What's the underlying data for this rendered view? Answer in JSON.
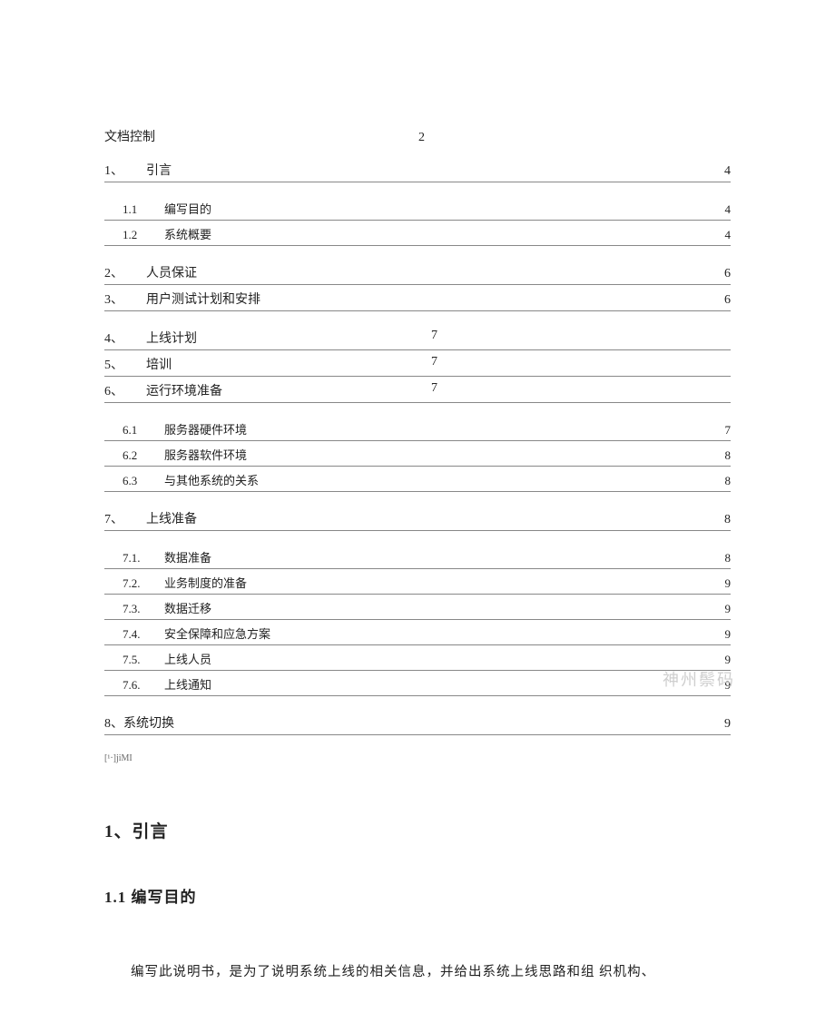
{
  "toc_header": {
    "label": "文档控制",
    "page": "2"
  },
  "toc": [
    {
      "lvl": 1,
      "num": "1、",
      "title": "引言",
      "page": "4",
      "align": "right",
      "gap": true
    },
    {
      "lvl": 2,
      "num": "1.1",
      "title": "编写目的",
      "page": "4",
      "align": "right"
    },
    {
      "lvl": 2,
      "num": "1.2",
      "title": "系统概要",
      "page": "4",
      "align": "right",
      "gap": true
    },
    {
      "lvl": 1,
      "num": "2、",
      "title": "人员保证",
      "page": "6",
      "align": "right"
    },
    {
      "lvl": 1,
      "num": "3、",
      "title": "用户测试计划和安排",
      "page": "6",
      "align": "right",
      "gap": true
    },
    {
      "lvl": 1,
      "num": "4、",
      "title": "上线计划",
      "page": "7",
      "align": "mid"
    },
    {
      "lvl": 1,
      "num": "5、",
      "title": "培训",
      "page": "7",
      "align": "mid"
    },
    {
      "lvl": 1,
      "num": "6、",
      "title": "运行环境准备",
      "page": "7",
      "align": "mid",
      "gap": true
    },
    {
      "lvl": 2,
      "num": "6.1",
      "title": "服务器硬件环境",
      "page": "7",
      "align": "right"
    },
    {
      "lvl": 2,
      "num": "6.2",
      "title": "服务器软件环境",
      "page": "8",
      "align": "right"
    },
    {
      "lvl": 2,
      "num": "6.3",
      "title": "与其他系统的关系",
      "page": "8",
      "align": "right",
      "gap": true
    },
    {
      "lvl": 1,
      "num": "7、",
      "title": "上线准备",
      "page": "8",
      "align": "right",
      "gap": true
    },
    {
      "lvl": 2,
      "num": "7.1.",
      "title": "数据准备",
      "page": "8",
      "align": "right"
    },
    {
      "lvl": 2,
      "num": "7.2.",
      "title": "业务制度的准备",
      "page": "9",
      "align": "right"
    },
    {
      "lvl": 2,
      "num": "7.3.",
      "title": "数据迁移",
      "page": "9",
      "align": "right"
    },
    {
      "lvl": 2,
      "num": "7.4.",
      "title": "安全保障和应急方案",
      "page": "9",
      "align": "right"
    },
    {
      "lvl": 2,
      "num": "7.5.",
      "title": "上线人员",
      "page": "9",
      "align": "right"
    },
    {
      "lvl": 2,
      "num": "7.6.",
      "title": "上线通知",
      "page": "9",
      "align": "right",
      "gap": true
    },
    {
      "lvl": 1,
      "num": "8、",
      "title": "系统切换",
      "page": "9",
      "align": "right",
      "tight": true
    }
  ],
  "footnote": "[¹·]jiMI",
  "watermark": "神州鬃码",
  "section1": {
    "heading": "1、引言"
  },
  "section11": {
    "heading": "1.1 编写目的"
  },
  "paragraph": "编写此说明书，是为了说明系统上线的相关信息，并给出系统上线思路和组 织机构、"
}
